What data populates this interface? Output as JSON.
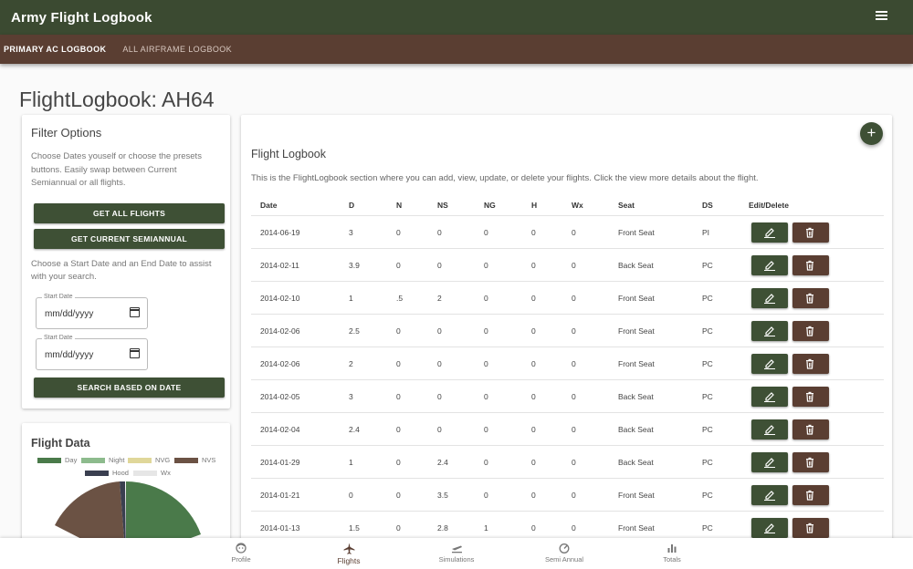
{
  "app": {
    "title": "Army Flight Logbook",
    "menu_icon": "hamburger-menu-icon"
  },
  "tabs": [
    {
      "label": "PRIMARY AC LOGBOOK",
      "active": true
    },
    {
      "label": "ALL AIRFRAME LOGBOOK",
      "active": false
    }
  ],
  "page_title": "FlightLogbook: AH64",
  "filter": {
    "title": "Filter Options",
    "intro": "Choose Dates youself or choose the presets buttons. Easily swap between Current Semiannual or all flights.",
    "get_all_label": "GET ALL FLIGHTS",
    "get_semiannual_label": "GET CURRENT SEMIANNUAL",
    "date_help": "Choose a Start Date and an End Date to assist with your search.",
    "start_label": "Start Date",
    "start_value": "mm/dd/yyyy",
    "end_label": "Start Date",
    "end_value": "mm/dd/yyyy",
    "search_label": "SEARCH BASED ON DATE"
  },
  "flight_data": {
    "title": "Flight Data",
    "legend": [
      {
        "label": "Day",
        "color": "#4a7a4a"
      },
      {
        "label": "Night",
        "color": "#8dbb8d"
      },
      {
        "label": "NVG",
        "color": "#e0d79a"
      },
      {
        "label": "NVS",
        "color": "#6b5244"
      },
      {
        "label": "Hood",
        "color": "#3a3f50"
      },
      {
        "label": "Wx",
        "color": "#e6e6e6"
      }
    ]
  },
  "logbook": {
    "title": "Flight Logbook",
    "description": "This is the FlightLogbook section where you can add, view, update, or delete your flights. Click the view more details about the flight.",
    "add_icon": "plus-icon",
    "columns": [
      "Date",
      "D",
      "N",
      "NS",
      "NG",
      "H",
      "Wx",
      "Seat",
      "DS",
      "Edit/Delete"
    ],
    "rows": [
      [
        "2014-06-19",
        "3",
        "0",
        "0",
        "0",
        "0",
        "0",
        "Front Seat",
        "PI"
      ],
      [
        "2014-02-11",
        "3.9",
        "0",
        "0",
        "0",
        "0",
        "0",
        "Back Seat",
        "PC"
      ],
      [
        "2014-02-10",
        "1",
        ".5",
        "2",
        "0",
        "0",
        "0",
        "Front Seat",
        "PC"
      ],
      [
        "2014-02-06",
        "2.5",
        "0",
        "0",
        "0",
        "0",
        "0",
        "Front Seat",
        "PC"
      ],
      [
        "2014-02-06",
        "2",
        "0",
        "0",
        "0",
        "0",
        "0",
        "Front Seat",
        "PC"
      ],
      [
        "2014-02-05",
        "3",
        "0",
        "0",
        "0",
        "0",
        "0",
        "Back Seat",
        "PC"
      ],
      [
        "2014-02-04",
        "2.4",
        "0",
        "0",
        "0",
        "0",
        "0",
        "Back Seat",
        "PC"
      ],
      [
        "2014-01-29",
        "1",
        "0",
        "2.4",
        "0",
        "0",
        "0",
        "Back Seat",
        "PC"
      ],
      [
        "2014-01-21",
        "0",
        "0",
        "3.5",
        "0",
        "0",
        "0",
        "Front Seat",
        "PC"
      ],
      [
        "2014-01-13",
        "1.5",
        "0",
        "2.8",
        "1",
        "0",
        "0",
        "Front Seat",
        "PC"
      ]
    ]
  },
  "bottom_nav": [
    {
      "label": "Profile",
      "icon": "face-icon",
      "active": false
    },
    {
      "label": "Flights",
      "icon": "airplane-icon",
      "active": true
    },
    {
      "label": "Simulations",
      "icon": "takeoff-icon",
      "active": false
    },
    {
      "label": "Semi Annual",
      "icon": "speedometer-icon",
      "active": false
    },
    {
      "label": "Totals",
      "icon": "bar-chart-icon",
      "active": false
    }
  ]
}
